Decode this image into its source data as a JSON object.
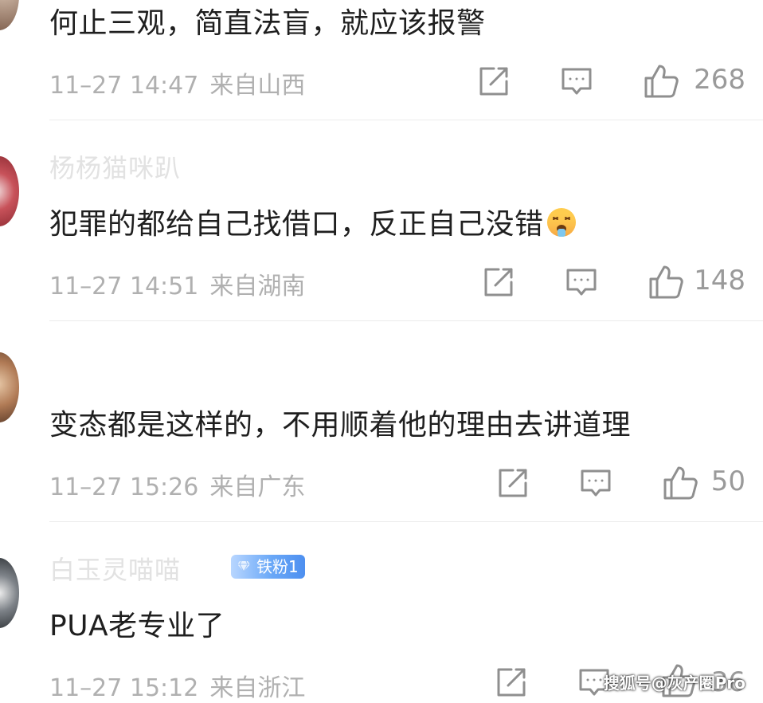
{
  "comments": [
    {
      "username": "",
      "text": "何止三观，简直法盲，就应该报警",
      "time": "11–27 14:47",
      "location": "来自山西",
      "likes": "268"
    },
    {
      "username": "杨杨猫咪趴",
      "text": "犯罪的都给自己找借口，反正自己没错",
      "emoji": "dizzy-hot-face-emoji",
      "time": "11–27 14:51",
      "location": "来自湖南",
      "likes": "148"
    },
    {
      "username": "",
      "text": "变态都是这样的，不用顺着他的理由去讲道理",
      "time": "11–27 15:26",
      "location": "来自广东",
      "likes": "50"
    },
    {
      "username": "白玉灵喵喵",
      "badge": "铁粉1",
      "text": "PUA老专业了",
      "time": "11–27 15:12",
      "location": "来自浙江",
      "likes": "36"
    }
  ],
  "icons": {
    "share": "share-icon",
    "reply": "comment-icon",
    "like": "thumbs-up-icon"
  },
  "colors": {
    "text": "#1f1f1f",
    "meta": "#b0b0b0",
    "icon": "#8f8f8f",
    "badge": "#5b9bf5"
  },
  "watermark": "搜狐号@灰产圈Pro"
}
